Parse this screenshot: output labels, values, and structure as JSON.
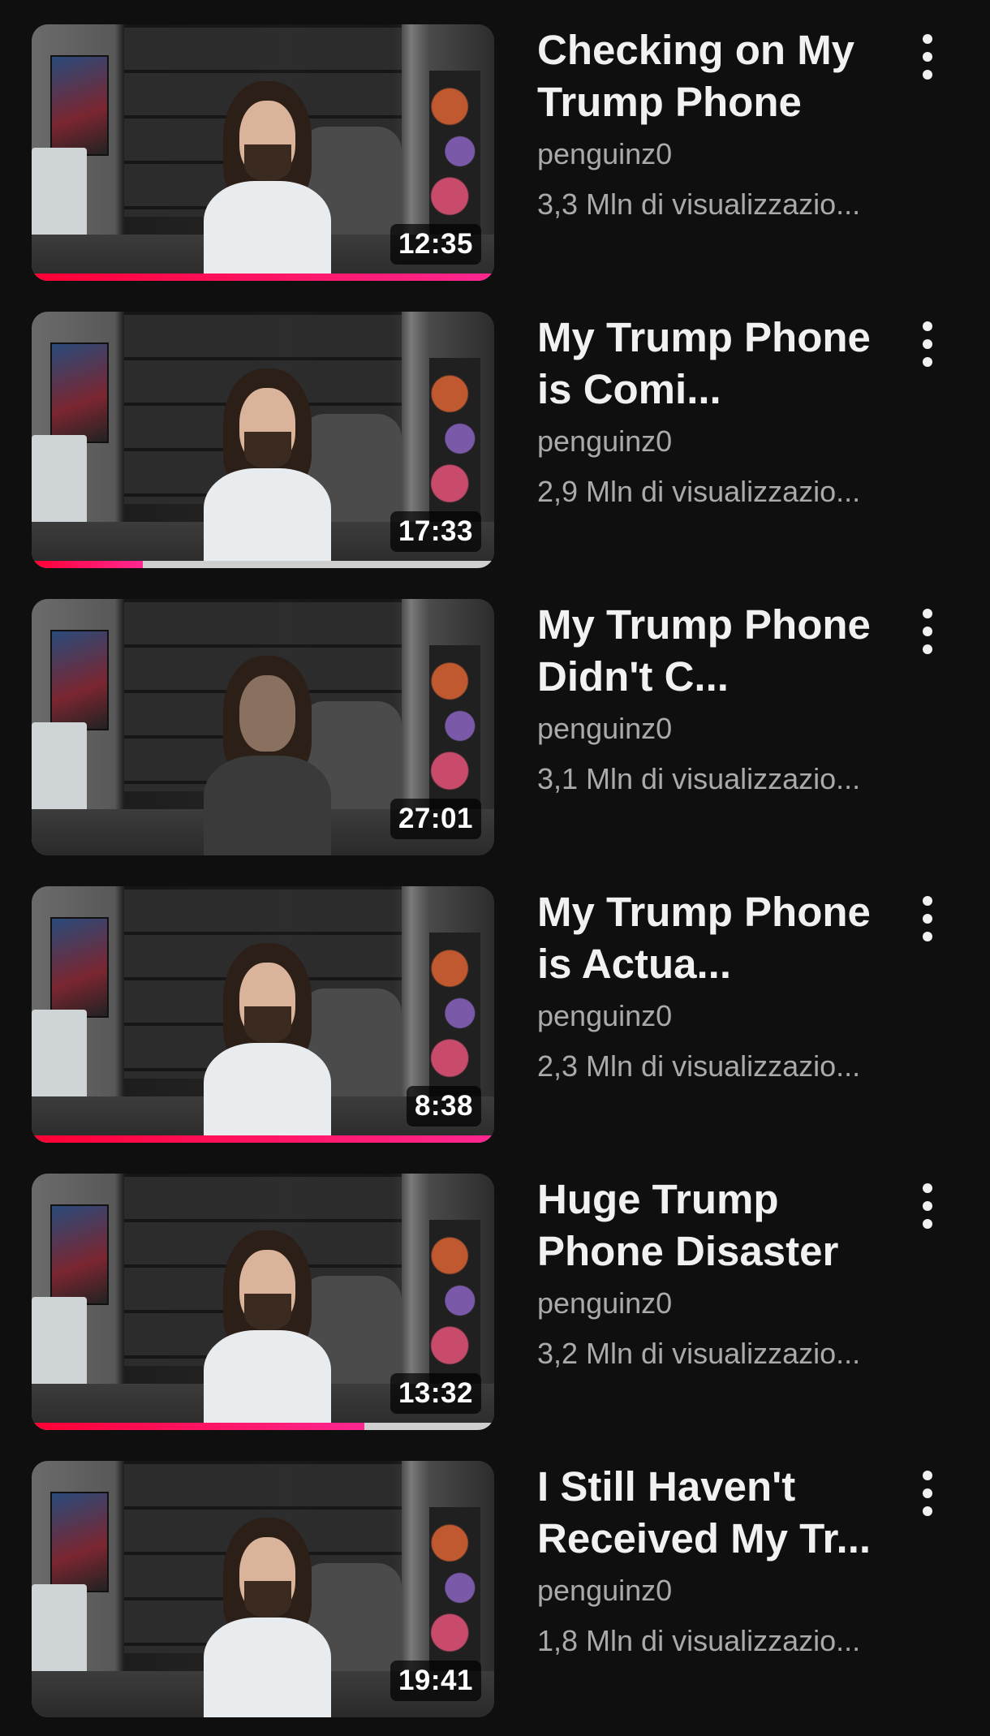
{
  "videos": [
    {
      "title": "Checking on My Trump Phone",
      "channel": "penguinz0",
      "views": "3,3 Mln di visualizzazio...",
      "duration": "12:35",
      "watched_fraction": 1.0,
      "menu_icon": "more-vert-icon"
    },
    {
      "title": "My Trump Phone is Comi...",
      "channel": "penguinz0",
      "views": "2,9 Mln di visualizzazio...",
      "duration": "17:33",
      "watched_fraction": 0.24,
      "menu_icon": "more-vert-icon"
    },
    {
      "title": "My Trump Phone Didn't C...",
      "channel": "penguinz0",
      "views": "3,1 Mln di visualizzazio...",
      "duration": "27:01",
      "watched_fraction": 0,
      "menu_icon": "more-vert-icon"
    },
    {
      "title": "My Trump Phone is Actua...",
      "channel": "penguinz0",
      "views": "2,3 Mln di visualizzazio...",
      "duration": "8:38",
      "watched_fraction": 1.0,
      "menu_icon": "more-vert-icon"
    },
    {
      "title": "Huge Trump Phone Disaster",
      "channel": "penguinz0",
      "views": "3,2 Mln di visualizzazio...",
      "duration": "13:32",
      "watched_fraction": 0.72,
      "menu_icon": "more-vert-icon"
    },
    {
      "title": "I Still Haven't Received My Tr...",
      "channel": "penguinz0",
      "views": "1,8 Mln di visualizzazio...",
      "duration": "19:41",
      "watched_fraction": 0,
      "menu_icon": "more-vert-icon"
    }
  ],
  "colors": {
    "background": "#0f0f0f",
    "progress": "#ff0033",
    "secondary_text": "#aaaaaa"
  }
}
